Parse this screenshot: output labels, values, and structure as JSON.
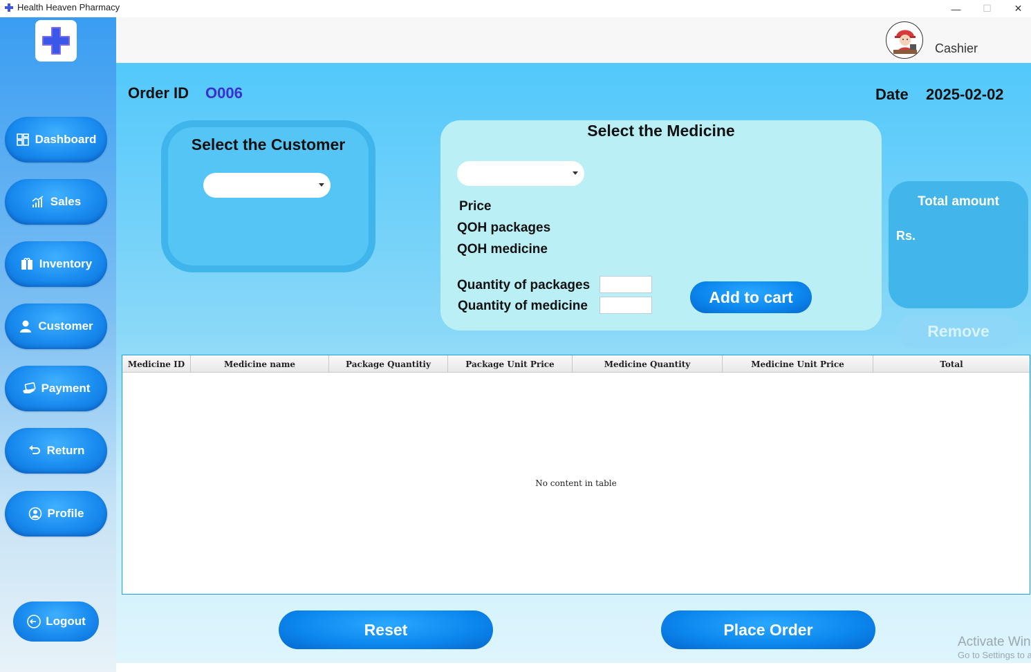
{
  "window": {
    "title": "Health Heaven Pharmacy",
    "minimize": "—",
    "maximize": "☐",
    "close": "✕"
  },
  "sidebar": {
    "items": [
      {
        "label": "Dashboard",
        "icon": "dashboard-icon"
      },
      {
        "label": "Sales",
        "icon": "sales-chart-icon"
      },
      {
        "label": "Inventory",
        "icon": "inventory-box-icon"
      },
      {
        "label": "Customer",
        "icon": "user-icon"
      },
      {
        "label": "Payment",
        "icon": "payment-card-icon"
      },
      {
        "label": "Return",
        "icon": "return-arrow-icon"
      },
      {
        "label": "Profile",
        "icon": "profile-icon"
      }
    ],
    "logout": "Logout"
  },
  "header": {
    "role": "Cashier"
  },
  "order": {
    "id_label": "Order ID",
    "id_value": "O006",
    "date_label": "Date",
    "date_value": "2025-02-02"
  },
  "customer": {
    "title": "Select the Customer",
    "selected": ""
  },
  "medicine": {
    "title": "Select the Medicine",
    "selected": "",
    "price_label": "Price",
    "qoh_packages_label": "QOH packages",
    "qoh_medicine_label": "QOH medicine",
    "qty_packages_label": "Quantity of packages",
    "qty_medicine_label": "Quantity of medicine",
    "qty_packages_value": "",
    "qty_medicine_value": "",
    "add_to_cart": "Add to cart"
  },
  "total": {
    "title": "Total amount",
    "currency": "Rs.",
    "remove": "Remove"
  },
  "table": {
    "columns": [
      "Medicine ID",
      "Medicine name",
      "Package Quantitiy",
      "Package Unit Price",
      "Medicine Quantity",
      "Medicine Unit Price",
      "Total"
    ],
    "empty_text": "No content in table"
  },
  "actions": {
    "reset": "Reset",
    "place_order": "Place Order"
  },
  "watermark": {
    "line1": "Activate Windows",
    "line2": "Go to Settings to activate Windows."
  },
  "colors": {
    "accent": "#0b86ee",
    "order_id": "#3a2fd0",
    "panel": "#42b5ea"
  }
}
